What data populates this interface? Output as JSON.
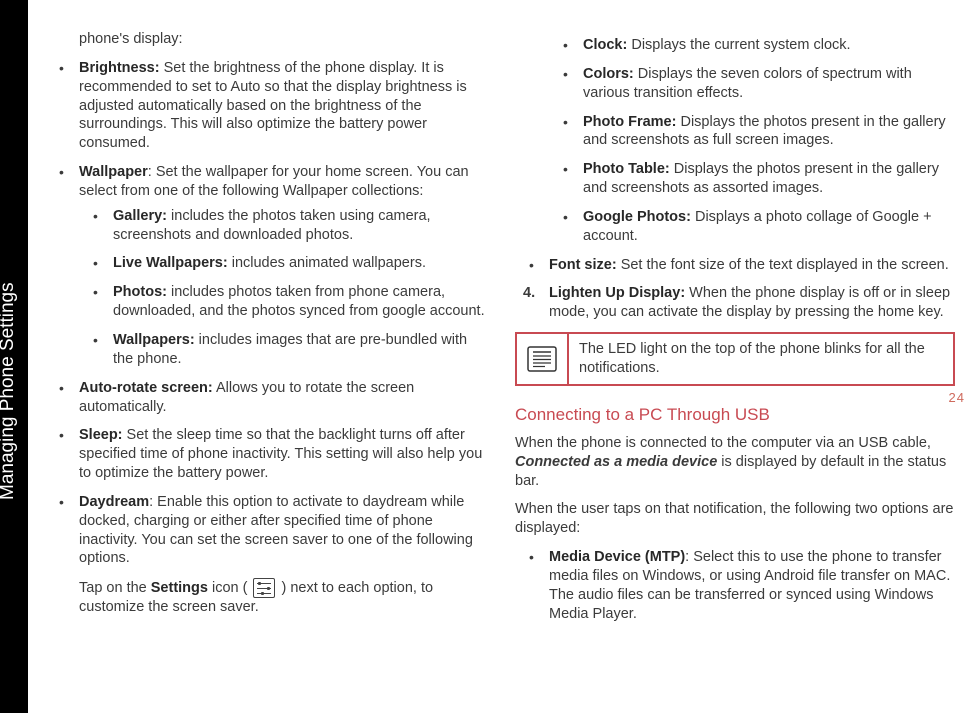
{
  "rail": {
    "title": "Managing Phone Settings"
  },
  "page_number": "24",
  "left": {
    "frag": "phone's display:",
    "items": [
      {
        "label": "Brightness:",
        "text": " Set the brightness of the phone display. It is recommended to set to Auto so that the display brightness is adjusted automatically based on the brightness of the surroundings. This will also optimize the battery power consumed."
      },
      {
        "label": "Wallpaper",
        "text": ": Set the wallpaper for your home screen. You can select from one of the following Wallpaper collections:",
        "sub": [
          {
            "label": "Gallery:",
            "text": " includes the photos taken using camera, screenshots and downloaded photos."
          },
          {
            "label": "Live Wallpapers:",
            "text": " includes animated wallpapers."
          },
          {
            "label": "Photos:",
            "text": " includes photos taken from phone camera, downloaded, and the photos synced from google account."
          },
          {
            "label": "Wallpapers:",
            "text": " includes images that are pre-bundled with the phone."
          }
        ]
      },
      {
        "label": "Auto-rotate screen:",
        "text": " Allows you to rotate the screen automatically."
      },
      {
        "label": "Sleep:",
        "text": " Set the sleep time so that the backlight turns off after specified time of phone inactivity. This setting will also help you to optimize the battery power."
      },
      {
        "label": "Daydream",
        "text": ": Enable this option to activate to daydream while docked, charging or either after specified time of phone inactivity. You can set the screen saver to one of the following options."
      }
    ],
    "tap_pre": "Tap on the ",
    "tap_bold": "Settings",
    "tap_mid": " icon ( ",
    "tap_post": " ) next to each option, to customize the screen saver."
  },
  "right": {
    "items_top": [
      {
        "label": "Clock:",
        "text": " Displays the current system clock."
      },
      {
        "label": "Colors:",
        "text": " Displays the seven colors of spectrum with various transition effects."
      },
      {
        "label": "Photo Frame:",
        "text": " Displays the photos present in the gallery and screenshots as full screen images."
      },
      {
        "label": "Photo Table:",
        "text": " Displays the photos present in the gallery and screenshots as assorted images."
      },
      {
        "label": "Google Photos:",
        "text": " Displays a photo collage of Google + account."
      }
    ],
    "font_size": {
      "label": "Font size:",
      "text": " Set the font size of the text displayed in the screen."
    },
    "step4": {
      "num": "4.",
      "label": "Lighten Up Display:",
      "text": " When the phone display is off or in sleep mode, you can activate the display by pressing the home key."
    },
    "note": "The LED light on the top of the phone blinks for all the notifications.",
    "section_title": "Connecting to a PC Through USB",
    "p1_pre": "When the phone is connected to the computer via an USB cable, ",
    "p1_bold": "Connected as a media device",
    "p1_post": " is displayed by default in the status bar.",
    "p2": "When the user taps on that notification, the following two options are displayed:",
    "mtp": {
      "label": "Media Device (MTP)",
      "text": ": Select this to use the phone to transfer media files on Windows, or using Android file transfer on MAC. The audio files can be transferred or synced using Windows Media Player."
    }
  }
}
